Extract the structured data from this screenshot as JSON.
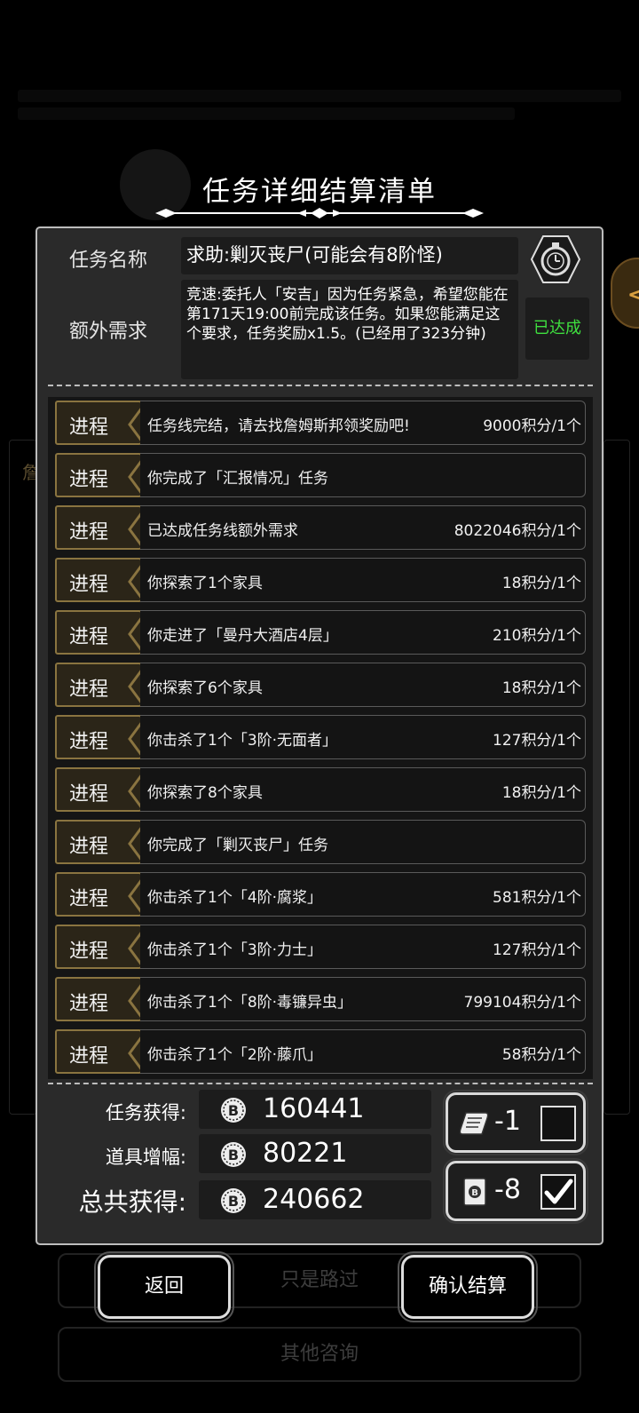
{
  "header": {
    "title": "任务详细结算清单"
  },
  "task": {
    "name_label": "任务名称",
    "name_value": "求助:剿灭丧尸(可能会有8阶怪)",
    "extra_label": "额外需求",
    "extra_value": "竞速:委托人「安吉」因为任务紧急，希望您能在第171天19:00前完成该任务。如果您能满足这个要求，任务奖励x1.5。(已经用了323分钟)",
    "status": "已达成",
    "status_color": "#3fe03f"
  },
  "progress": {
    "tag_label": "进程",
    "rows": [
      {
        "desc": "任务线完结，请去找詹姆斯邦领奖励吧!",
        "points": "9000积分/1个"
      },
      {
        "desc": "你完成了「汇报情况」任务",
        "points": ""
      },
      {
        "desc": "已达成任务线额外需求",
        "points": "8022046积分/1个"
      },
      {
        "desc": "你探索了1个家具",
        "points": "18积分/1个"
      },
      {
        "desc": "你走进了「曼丹大酒店4层」",
        "points": "210积分/1个"
      },
      {
        "desc": "你探索了6个家具",
        "points": "18积分/1个"
      },
      {
        "desc": "你击杀了1个「3阶·无面者」",
        "points": "127积分/1个"
      },
      {
        "desc": "你探索了8个家具",
        "points": "18积分/1个"
      },
      {
        "desc": "你完成了「剿灭丧尸」任务",
        "points": ""
      },
      {
        "desc": "你击杀了1个「4阶·腐浆」",
        "points": "581积分/1个"
      },
      {
        "desc": "你击杀了1个「3阶·力士」",
        "points": "127积分/1个"
      },
      {
        "desc": "你击杀了1个「8阶·毒镰异虫」",
        "points": "799104积分/1个"
      },
      {
        "desc": "你击杀了1个「2阶·藤爪」",
        "points": "58积分/1个"
      }
    ]
  },
  "summary": {
    "task_label": "任务获得:",
    "task_value": "160441",
    "item_label": "道具增幅:",
    "item_value": "80221",
    "total_label": "总共获得:",
    "total_value": "240662"
  },
  "items": [
    {
      "icon": "scroll-icon",
      "value": "-1",
      "checked": false
    },
    {
      "icon": "card-icon",
      "value": "-8",
      "checked": true
    }
  ],
  "buttons": {
    "back": "返回",
    "confirm": "确认结算",
    "bg_pass": "只是路过",
    "bg_other": "其他咨询"
  },
  "background": {
    "side_char": "詹"
  }
}
